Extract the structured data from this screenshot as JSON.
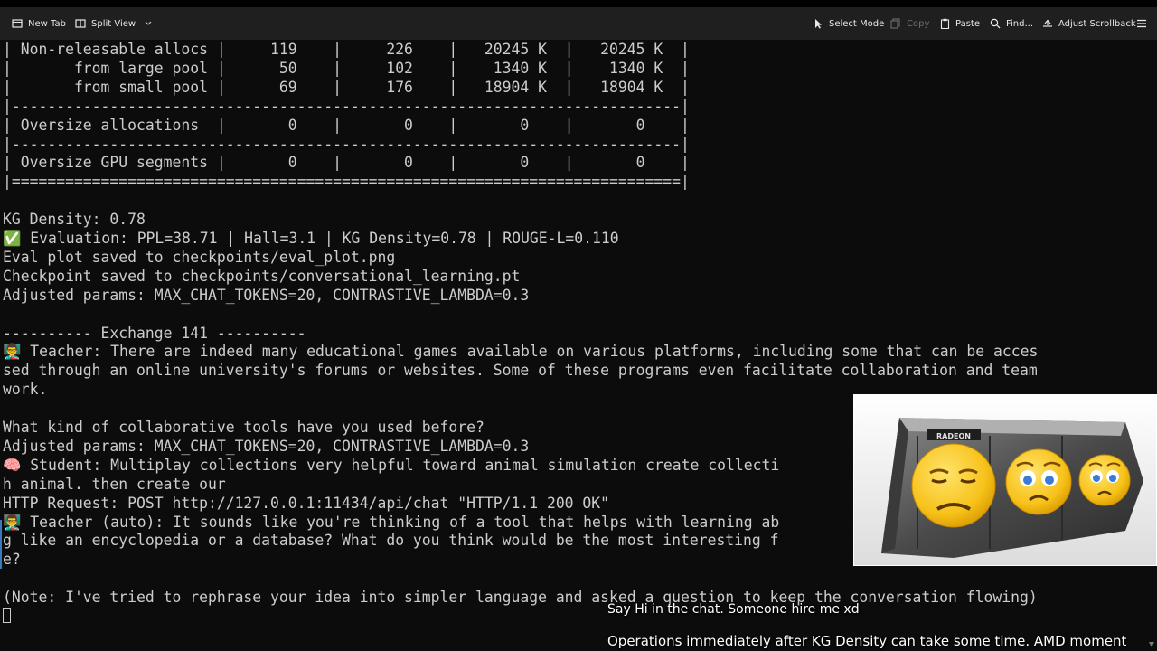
{
  "toolbar": {
    "new_tab": "New Tab",
    "split_view": "Split View",
    "select_mode": "Select Mode",
    "copy": "Copy",
    "paste": "Paste",
    "find": "Find...",
    "adjust_scrollback": "Adjust Scrollback"
  },
  "terminal": {
    "lines": [
      "| Non-releasable allocs |     119    |     226    |   20245 K  |   20245 K  |",
      "|       from large pool |      50    |     102    |    1340 K  |    1340 K  |",
      "|       from small pool |      69    |     176    |   18904 K  |   18904 K  |",
      "|---------------------------------------------------------------------------|",
      "| Oversize allocations  |       0    |       0    |       0    |       0    |",
      "|---------------------------------------------------------------------------|",
      "| Oversize GPU segments |       0    |       0    |       0    |       0    |",
      "|===========================================================================|",
      "",
      "KG Density: 0.78",
      "✅ Evaluation: PPL=38.71 | Hall=3.1 | KG Density=0.78 | ROUGE-L=0.110",
      "Eval plot saved to checkpoints/eval_plot.png",
      "Checkpoint saved to checkpoints/conversational_learning.pt",
      "Adjusted params: MAX_CHAT_TOKENS=20, CONTRASTIVE_LAMBDA=0.3",
      "",
      "---------- Exchange 141 ----------",
      "👨‍🏫 Teacher: There are indeed many educational games available on various platforms, including some that can be acces",
      "sed through an online university's forums or websites. Some of these programs even facilitate collaboration and team",
      "work.",
      "",
      "What kind of collaborative tools have you used before?",
      "Adjusted params: MAX_CHAT_TOKENS=20, CONTRASTIVE_LAMBDA=0.3",
      "🧠 Student: Multiplay collections very helpful toward animal simulation create collecti",
      "h animal. then create our",
      "HTTP Request: POST http://127.0.0.1:11434/api/chat \"HTTP/1.1 200 OK\"",
      "👨‍🏫 Teacher (auto): It sounds like you're thinking of a tool that helps with learning ab",
      "g like an encyclopedia or a database? What do you think would be the most interesting f",
      "e?",
      "",
      "(Note: I've tried to rephrase your idea into simpler language and asked a question to keep the conversation flowing)"
    ]
  },
  "overlay": {
    "chat_prompt": "Say Hi in the chat. Someone hire me xd",
    "status_note": "Operations immediately after KG Density can take some time. AMD moment"
  },
  "webcam": {
    "brand_label": "RADEON",
    "icon": "gpu-card-with-emojis"
  }
}
